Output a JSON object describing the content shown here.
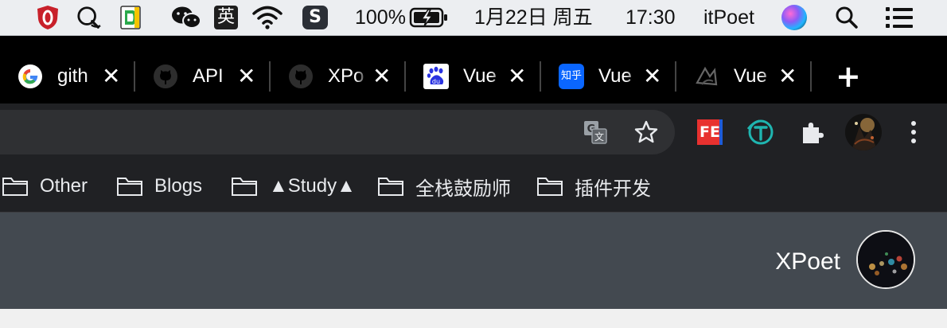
{
  "menubar": {
    "battery_percent": "100%",
    "date": "1月22日 周五",
    "time": "17:30",
    "user": "itPoet",
    "input_method": "英",
    "icons": [
      "antivirus-shield-icon",
      "chat-search-icon",
      "dash-doc-icon",
      "wechat-icon",
      "input-method-icon",
      "wifi-icon",
      "sogou-icon",
      "battery-charging-icon",
      "siri-icon",
      "spotlight-search-icon",
      "control-center-icon"
    ]
  },
  "tabs": [
    {
      "title": "gith",
      "favicon": "google-icon"
    },
    {
      "title": "API",
      "favicon": "github-icon"
    },
    {
      "title": "XPo",
      "favicon": "github-icon"
    },
    {
      "title": "Vue",
      "favicon": "baidu-icon"
    },
    {
      "title": "Vue",
      "favicon": "zhihu-icon",
      "favicon_text": "知乎"
    },
    {
      "title": "Vue",
      "favicon": "blog-logo-icon"
    }
  ],
  "tab_close_glyph": "✕",
  "new_tab_glyph": "+",
  "toolbar": {
    "fe_badge": "FE",
    "extensions": [
      "translate-icon",
      "bookmark-star-icon",
      "fe-extension-icon",
      "t-extension-icon",
      "extensions-puzzle-icon",
      "profile-avatar",
      "more-menu-icon"
    ]
  },
  "bookmarks": [
    {
      "label": "Other"
    },
    {
      "label": "Blogs"
    },
    {
      "label": "▲Study▲"
    },
    {
      "label": "全栈鼓励师"
    },
    {
      "label": "插件开发"
    }
  ],
  "page": {
    "username": "XPoet"
  },
  "colors": {
    "tabstrip_bg": "#000000",
    "toolbar_bg": "#202124",
    "header_bg": "#434950",
    "menubar_bg": "#eceef1"
  }
}
